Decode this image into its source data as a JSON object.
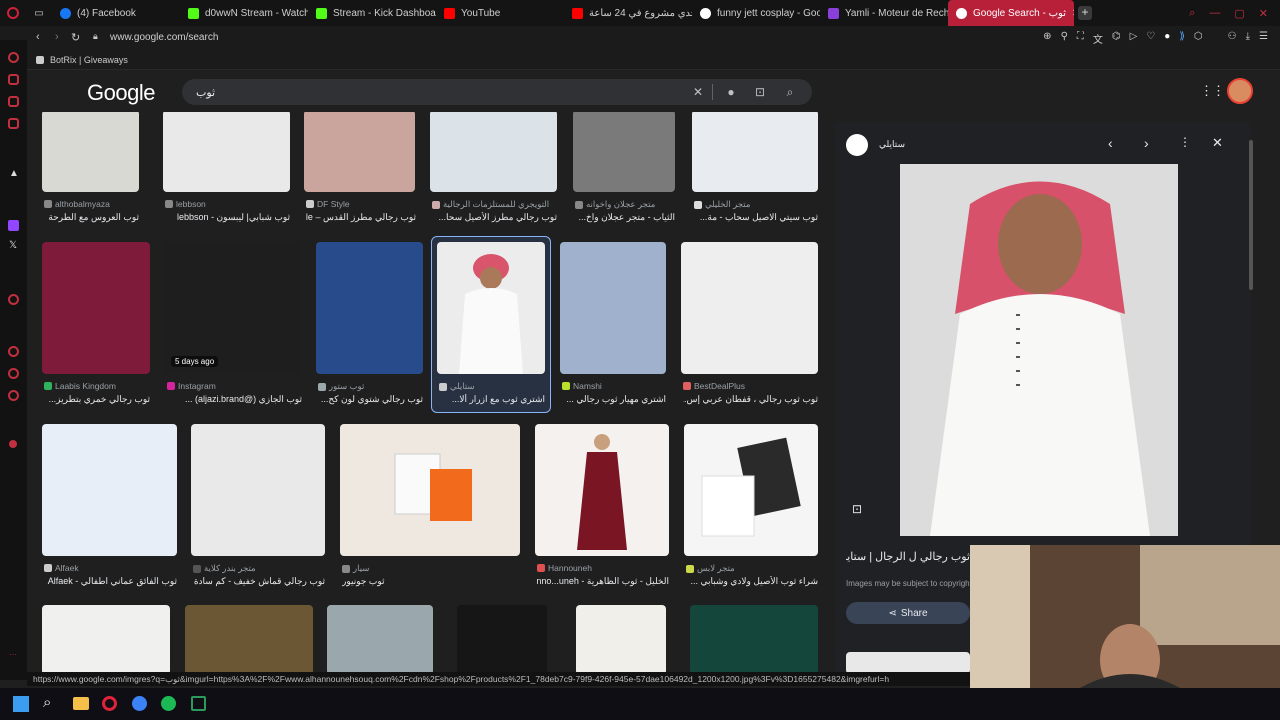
{
  "tabs": [
    {
      "label": "(4) Facebook",
      "color": "#1877f2"
    },
    {
      "label": "d0wwN Stream - Watch L",
      "color": "#53fc18"
    },
    {
      "label": "Stream - Kick Dashboard",
      "color": "#53fc18"
    },
    {
      "label": "YouTube",
      "color": "#ff0000"
    },
    {
      "label": "تحدي مشروع في 24 ساعة",
      "color": "#ff0000"
    },
    {
      "label": "funny jett cosplay - Goog",
      "color": "#ffffff"
    },
    {
      "label": "Yamli - Moteur de Recher",
      "color": "#8b3fd9"
    },
    {
      "label": "Google Search - ثوب",
      "color": "#ffffff",
      "active": true
    }
  ],
  "address": {
    "url": "www.google.com/search"
  },
  "bookmarks": {
    "item": "BotRix | Giveaways"
  },
  "google": {
    "logo": "Google",
    "query": "ثوب"
  },
  "grid": {
    "row1": [
      {
        "source": "althobalmyaza",
        "title": "ثوب العروس مع الطرحة",
        "color": "#d9d9d4"
      },
      {
        "source": "lebbson",
        "title": "ثوب شبابي| ليبسون - lebbson",
        "color": "#e9e9e9"
      },
      {
        "source": "DF Style",
        "title": "ثوب رجالي مطرز القدس – DF Style",
        "color": "#c9a59e"
      },
      {
        "source": "التويجري للمستلزمات الرجالية",
        "title": "ثوب رجالي مطرز الأصيل سحا...",
        "color": "#dbe3e8"
      },
      {
        "source": "متجر عجلان واخوانه",
        "title": "الثياب - متجر عجلان واخ...",
        "color": "#7a7a7a"
      },
      {
        "source": "متجر الخليلي",
        "title": "ثوب سيتي الاصيل سحاب - مة...",
        "color": "#e8ecf0"
      }
    ],
    "row2": [
      {
        "source": "Laabis Kingdom",
        "title": "ثوب رجالي خمري بتطريز...",
        "color": "#7e1a3a"
      },
      {
        "source": "Instagram",
        "title": "ثوب الجازي (@aljazi.brand) ...",
        "color": "#1e1e1e",
        "badge": "5 days ago"
      },
      {
        "source": "ثوب ستور",
        "title": "ثوب رجالي شتوي لون كح...",
        "color": "#284b8c"
      },
      {
        "source": "ستايلي",
        "title": "اشتري ثوب مع ازرار ألا...",
        "color": "#ececec",
        "selected": true
      },
      {
        "source": "Namshi",
        "title": "اشتري مهيار ثوب رجالي ...",
        "color": "#9fb1cd"
      },
      {
        "source": "BestDealPlus",
        "title": "ثوب ثوب رجالي ، قفطان عربي إس...",
        "color": "#eeeeee"
      }
    ],
    "row3": [
      {
        "source": "Alfaek",
        "title": "ثوب الفائق عماني اطفالي - Alfaek",
        "color": "#e8eef8"
      },
      {
        "source": "متجر بندر كلاية",
        "title": "ثوب رجالي قماش خفيف - كم سادة",
        "color": "#e9e9ea"
      },
      {
        "source": "سيار",
        "title": "ثوب جونيور",
        "color": "#efe8e0"
      },
      {
        "source": "Hannouneh",
        "title": "الخليل - ثوب الظاهرية - Hanno...uneh",
        "color": "#f4f1ee"
      },
      {
        "source": "متجر لابس",
        "title": "شراء ثوب الأصيل ولادي وشبابي ...",
        "color": "#f5f5f5"
      }
    ],
    "row4_colors": [
      "#f0f0ef",
      "#6b5733",
      "#9aa7ad",
      "#161616",
      "#f1efea",
      "#14463b"
    ]
  },
  "panel": {
    "source": "ستايلي",
    "title": "ثوب رجالي ل الرجال | ستايلي السعودية",
    "notice": "Images may be subject to copyright.",
    "share": "Share"
  },
  "status": {
    "text": "https://www.google.com/imgres?q=ثوب&imgurl=https%3A%2F%2Fwww.alhannounehsouq.com%2Fcdn%2Fshop%2Fproducts%2F1_78deb7c9-79f9-426f-945e-57dae106492d_1200x1200.jpg%3Fv%3D1655275482&imgrefurl=h"
  }
}
